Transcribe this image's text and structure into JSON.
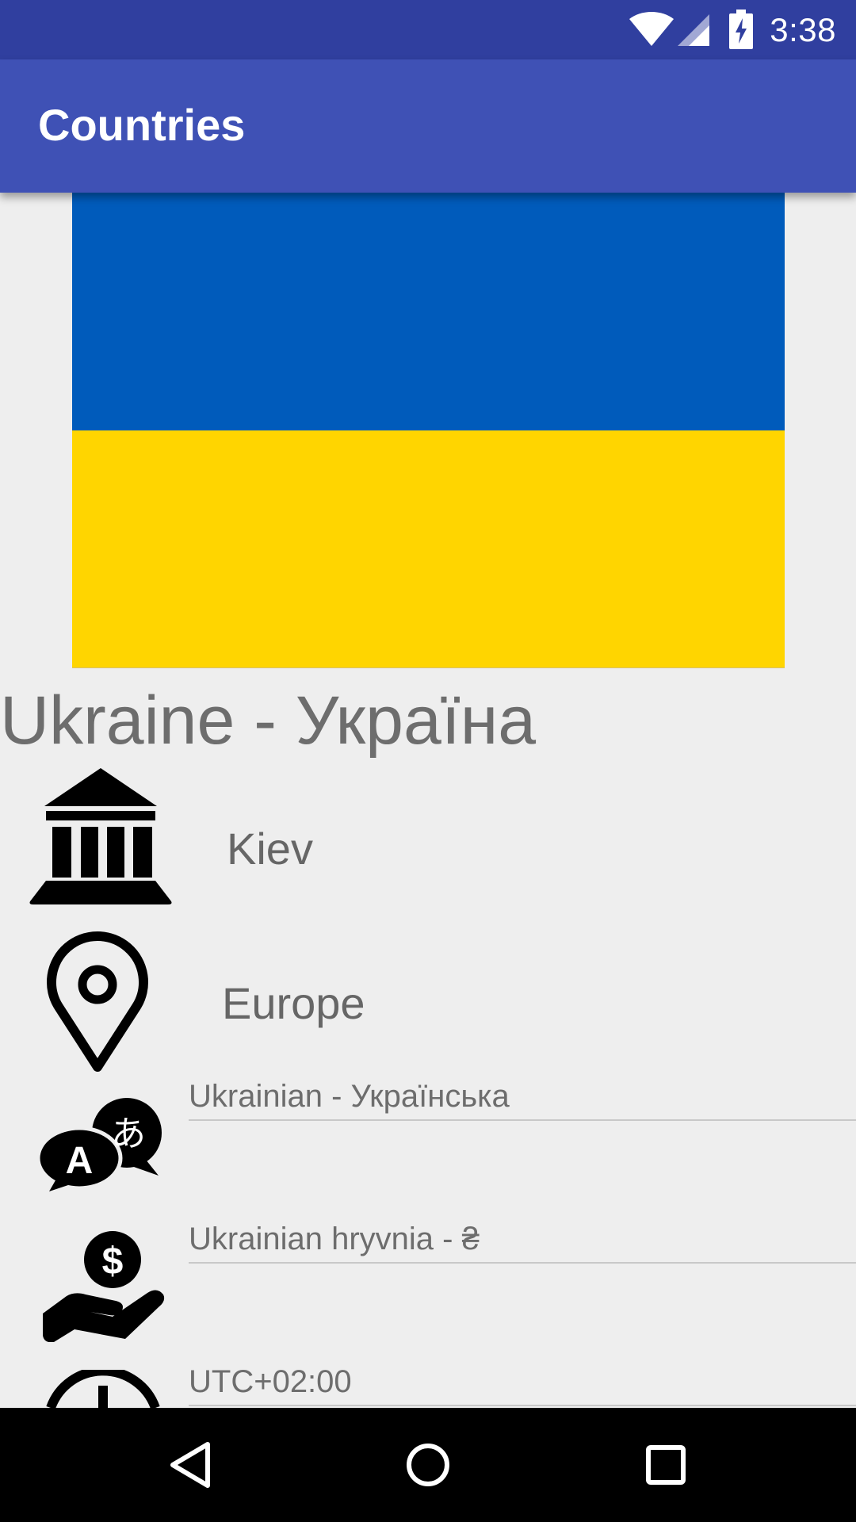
{
  "status_bar": {
    "time": "3:38",
    "icons": [
      "wifi-icon",
      "signal-icon",
      "battery-charging-icon"
    ]
  },
  "app_bar": {
    "title": "Countries"
  },
  "flag": {
    "colors": {
      "top": "#005bbb",
      "bottom": "#ffd500"
    }
  },
  "country": {
    "title": "Ukraine - Україна",
    "capital": "Kiev",
    "region": "Europe",
    "language": "Ukrainian - Українська",
    "currency": "Ukrainian hryvnia - ₴",
    "timezone": "UTC+02:00"
  },
  "icons": {
    "capital": "capital-building-icon",
    "region": "location-pin-icon",
    "language": "language-translate-icon",
    "currency": "hand-money-icon",
    "timezone": "clock-icon"
  },
  "nav_bar": {
    "buttons": [
      "back",
      "home",
      "recents"
    ]
  },
  "colors": {
    "status_bar": "#303f9f",
    "app_bar": "#3f51b5",
    "background": "#eeeeee",
    "text_secondary": "#6d6d6d"
  }
}
